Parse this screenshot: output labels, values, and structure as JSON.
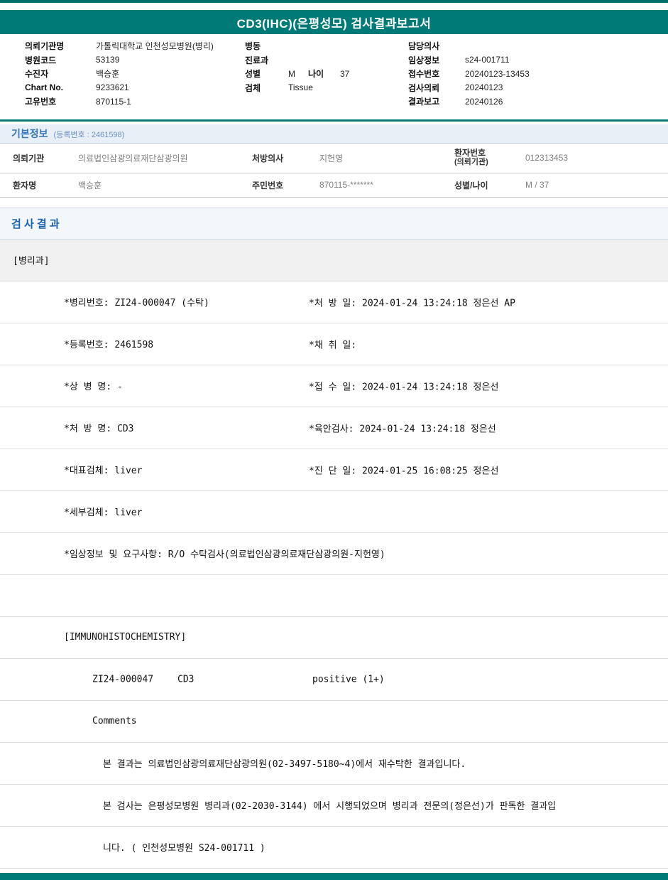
{
  "title": "CD3(IHC)(은평성모) 검사결과보고서",
  "patient_header": {
    "left": [
      {
        "label": "의뢰기관명",
        "value": "가톨릭대학교 인천성모병원(병리)"
      },
      {
        "label": "병원코드",
        "value": "53139"
      },
      {
        "label": "수진자",
        "value": "백승훈"
      },
      {
        "label": "Chart No.",
        "value": "9233621"
      },
      {
        "label": "고유번호",
        "value": "870115-1"
      }
    ],
    "middle": [
      {
        "label": "병동",
        "value": ""
      },
      {
        "label": "진료과",
        "value": ""
      },
      {
        "label": "성별",
        "value": "M",
        "label2": "나이",
        "value2": "37"
      },
      {
        "label": "검체",
        "value": "Tissue"
      }
    ],
    "right": [
      {
        "label": "담당의사",
        "value": ""
      },
      {
        "label": "임상정보",
        "value": "s24-001711"
      },
      {
        "label": "접수번호",
        "value": "20240123-13453"
      },
      {
        "label": "검사의뢰",
        "value": "20240123"
      },
      {
        "label": "결과보고",
        "value": "20240126"
      }
    ]
  },
  "basic_info": {
    "section_title": "기본정보",
    "reg_note": "(등록번호 : 2461598)",
    "row1": {
      "label1": "의뢰기관",
      "value1": "의료법인삼광의료재단삼광의원",
      "label2": "처방의사",
      "value2": "지헌영",
      "label3a": "환자번호",
      "label3b": "(의뢰기관)",
      "value3": "012313453"
    },
    "row2": {
      "label1": "환자명",
      "value1": "백승훈",
      "label2": "주민번호",
      "value2": "870115-*******",
      "label3": "성별/나이",
      "value3": "M / 37"
    }
  },
  "results": {
    "section_title": "검 사 결 과",
    "rows": [
      {
        "col1": "[병리과]"
      },
      {
        "col1": "*병리번호: ZI24-000047 (수탁)",
        "col2": "*처 방 일: 2024-01-24 13:24:18  정은선 AP"
      },
      {
        "col1": "*등록번호: 2461598",
        "col2": "*채 취 일:"
      },
      {
        "col1": "*상 병 명: -",
        "col2": "*접 수 일: 2024-01-24 13:24:18  정은선"
      },
      {
        "col1": "*처 방 명: CD3",
        "col2": "*육안검사: 2024-01-24 13:24:18  정은선"
      },
      {
        "col1": "*대표검체: liver",
        "col2": "*진 단 일: 2024-01-25 16:08:25  정은선"
      },
      {
        "col1": "*세부검체: liver"
      },
      {
        "col1": "*임상정보 및 요구사항: R/O 수탁검사(의료법인삼광의료재단삼광의원-지헌영)"
      },
      {
        "col1": ""
      },
      {
        "col1": "[IMMUNOHISTOCHEMISTRY]"
      },
      {
        "specimen": "ZI24-000047",
        "test": "CD3",
        "result": "positive (1+)"
      },
      {
        "col1": "Comments"
      },
      {
        "col1": "본 결과는 의료법인삼광의료재단삼광의원(02-3497-5180~4)에서 재수탁한 결과입니다."
      },
      {
        "col1": "본 검사는 은평성모병원 병리과(02-2030-3144) 에서 시행되었으며 병리과 전문의(정은선)가 판독한 결과입"
      },
      {
        "col1": "니다. ( 인천성모병원 S24-001711 )"
      }
    ]
  }
}
